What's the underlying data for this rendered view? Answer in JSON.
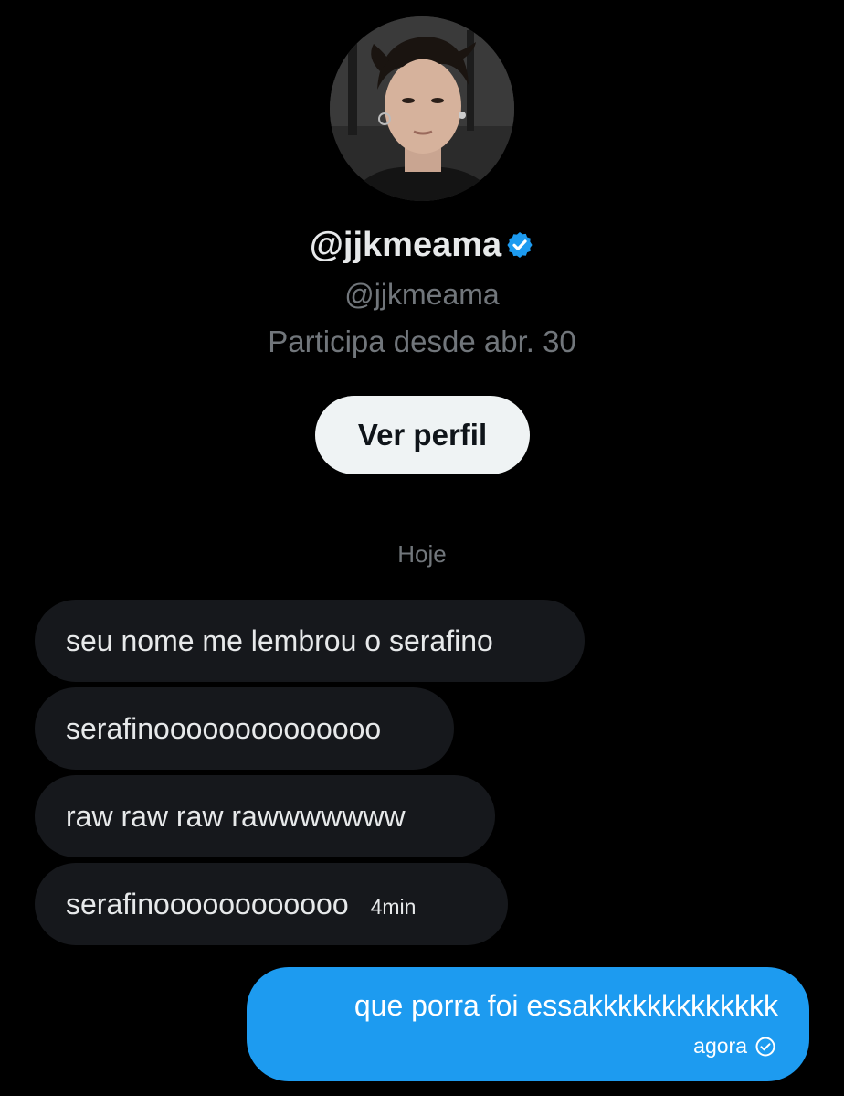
{
  "profile": {
    "display_name": "@jjkmeama",
    "handle": "@jjkmeama",
    "joined": "Participa desde abr. 30",
    "view_profile_label": "Ver perfil",
    "verified_icon": "verified-badge-icon",
    "verified_color": "#1d9bf0"
  },
  "conversation": {
    "date_separator": "Hoje",
    "incoming": [
      {
        "text": "seu nome me lembrou o serafino",
        "time": ""
      },
      {
        "text": "serafinoooooooooooooo",
        "time": ""
      },
      {
        "text": "raw raw raw rawwwwwww",
        "time": ""
      },
      {
        "text": "serafinoooooooooooo",
        "time": "4min"
      }
    ],
    "outgoing": [
      {
        "text": "que porra foi essakkkkkkkkkkkkk",
        "time": "agora",
        "status_icon": "sent-check-icon"
      }
    ]
  },
  "colors": {
    "background": "#000000",
    "incoming_bubble": "#16181c",
    "outgoing_bubble": "#1d9bf0",
    "secondary_text": "#71767b",
    "button_bg": "#eff3f4"
  }
}
